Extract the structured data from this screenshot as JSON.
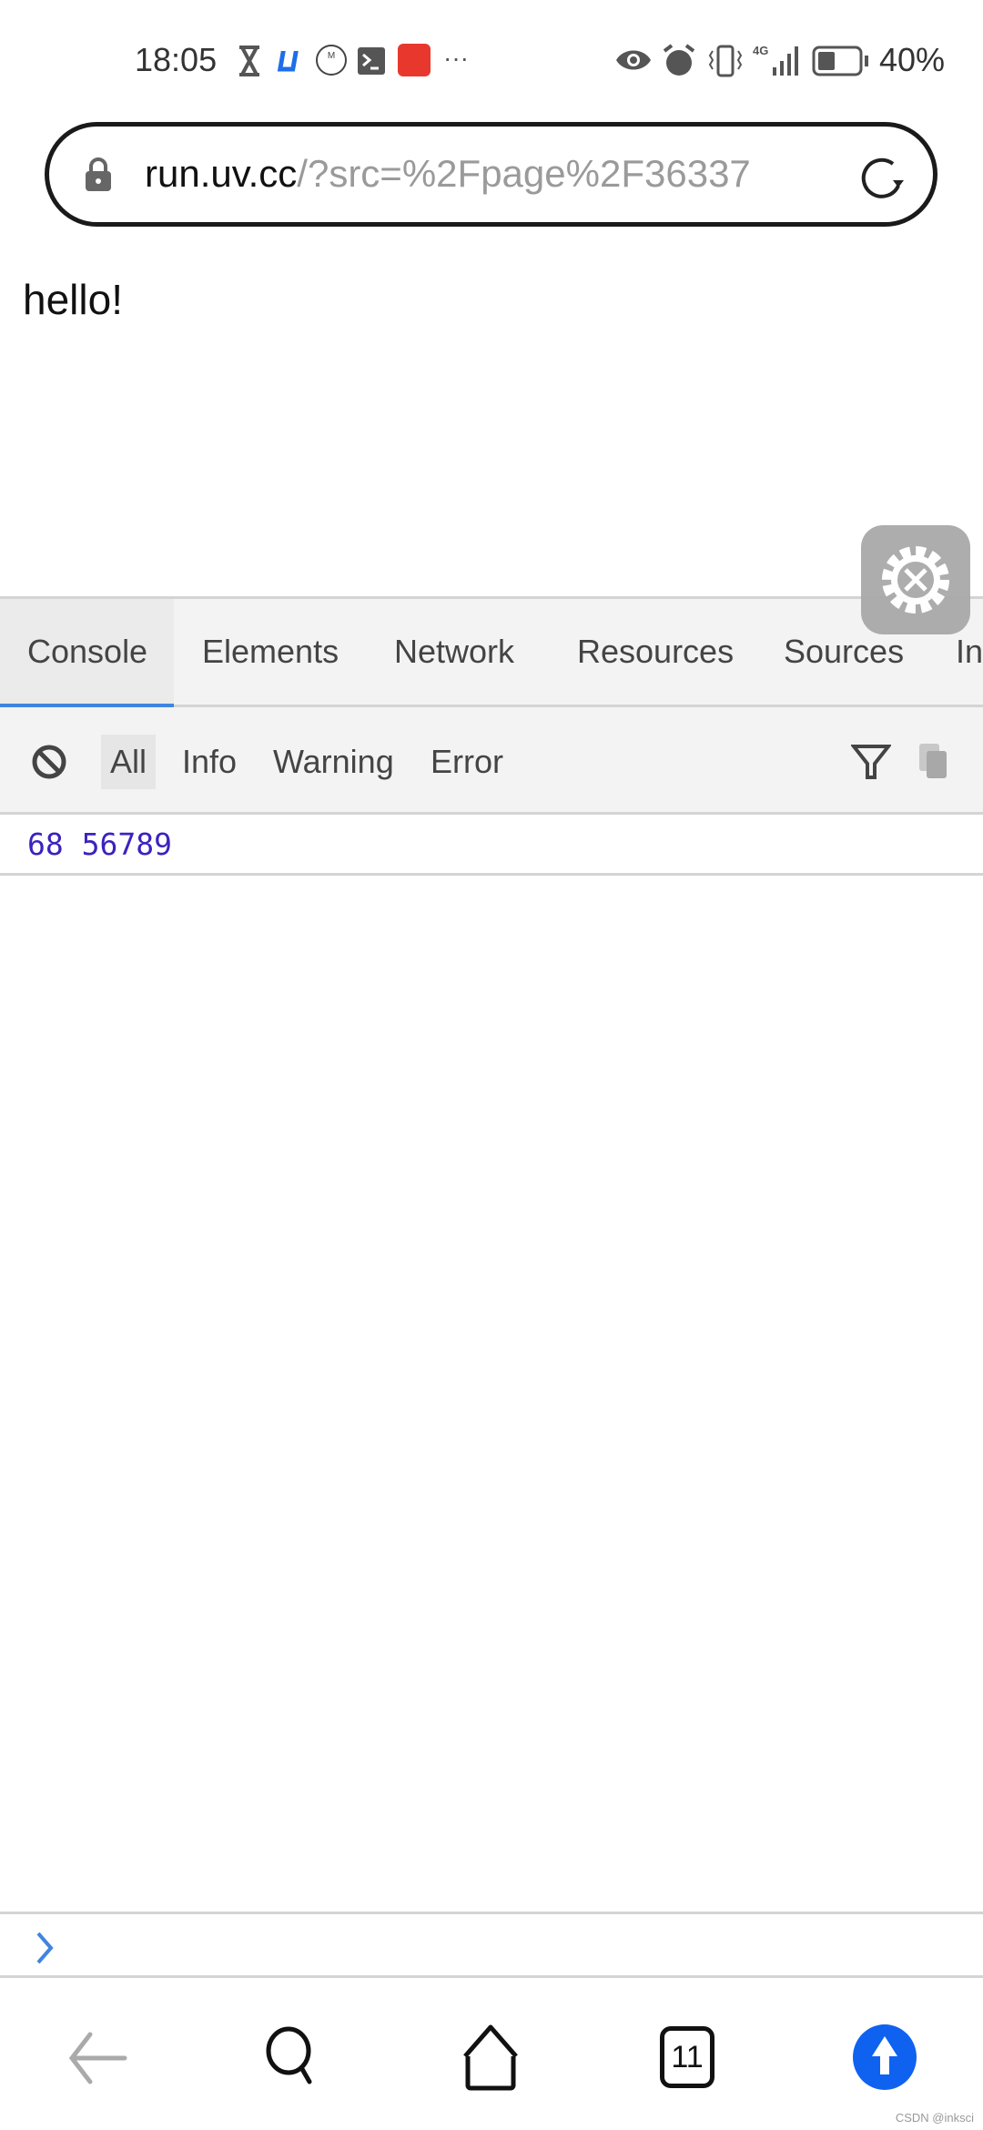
{
  "status_bar": {
    "time": "18:05",
    "battery": "40%",
    "network": "4G",
    "left_icons": [
      "hourglass-icon",
      "app-icon-blue",
      "jd-icon",
      "terminal-icon",
      "app-icon-red",
      "more-icon"
    ],
    "right_icons": [
      "eye-icon",
      "alarm-icon",
      "vibrate-icon",
      "signal-icon",
      "battery-icon"
    ]
  },
  "browser": {
    "url_host": "run.uv.cc",
    "url_rest": "/?src=%2Fpage%2F36337"
  },
  "page": {
    "text": "hello!"
  },
  "devtools": {
    "tabs": [
      "Console",
      "Elements",
      "Network",
      "Resources",
      "Sources",
      "In"
    ],
    "active_tab": "Console",
    "filters": [
      "All",
      "Info",
      "Warning",
      "Error"
    ],
    "active_filter": "All",
    "log": "68 56789",
    "accent": "#3f85e0",
    "log_color": "#3b22bf"
  },
  "nav_bar": {
    "tabs_count": "11",
    "accent": "#0f62f0"
  },
  "watermark": "CSDN @inksci"
}
